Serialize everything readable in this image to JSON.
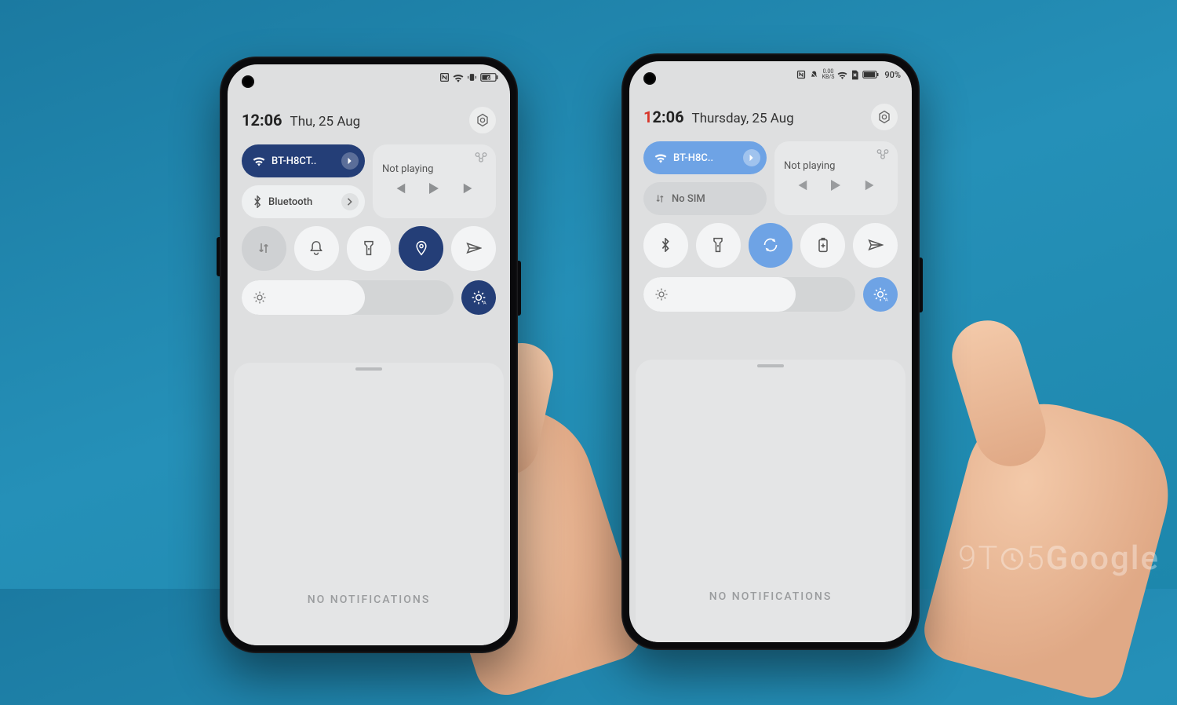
{
  "watermark": "9TO5Google",
  "left": {
    "statusbar": {
      "battery_text": "61"
    },
    "time": "12:06",
    "date": "Thu, 25 Aug",
    "wifi_tile": "BT-H8CT..",
    "bluetooth_tile": "Bluetooth",
    "media_status": "Not playing",
    "brightness_fill_pct": 58,
    "no_notifications": "NO NOTIFICATIONS",
    "tiles": {
      "data": "mobile-data",
      "dnd": "do-not-disturb",
      "torch": "flashlight",
      "location": "location",
      "airplane": "airplane-mode"
    },
    "colors": {
      "accent": "#243e77"
    }
  },
  "right": {
    "statusbar": {
      "speed": "0.00",
      "speed_unit": "KB/S",
      "battery_text": "90%"
    },
    "time_h": "1",
    "time_rest": "2:06",
    "date": "Thursday, 25 Aug",
    "wifi_tile": "BT-H8C..",
    "sim_tile": "No SIM",
    "media_status": "Not playing",
    "brightness_fill_pct": 72,
    "no_notifications": "NO NOTIFICATIONS",
    "tiles": {
      "bluetooth": "bluetooth",
      "torch": "flashlight",
      "rotate": "auto-rotate",
      "battery": "battery-saver",
      "airplane": "airplane-mode"
    },
    "colors": {
      "accent": "#6ea3e5"
    }
  }
}
